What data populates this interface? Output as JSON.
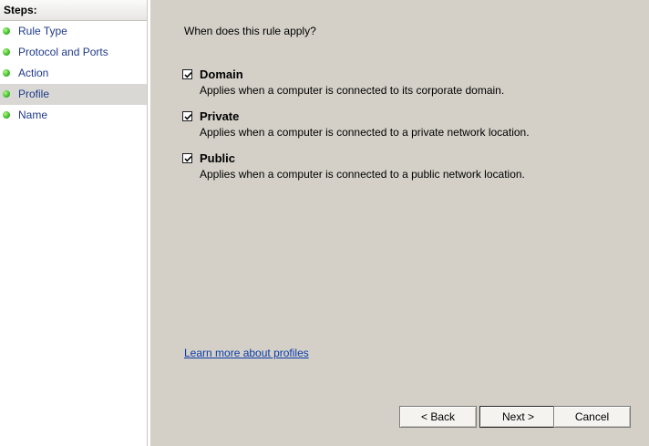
{
  "steps": {
    "header": "Steps:",
    "items": [
      {
        "label": "Rule Type"
      },
      {
        "label": "Protocol and Ports"
      },
      {
        "label": "Action"
      },
      {
        "label": "Profile"
      },
      {
        "label": "Name"
      }
    ]
  },
  "main": {
    "question": "When does this rule apply?",
    "profiles": [
      {
        "title": "Domain",
        "description": "Applies when a computer is connected to its corporate domain.",
        "checked": true
      },
      {
        "title": "Private",
        "description": "Applies when a computer is connected to a private network location.",
        "checked": true
      },
      {
        "title": "Public",
        "description": "Applies when a computer is connected to a public network location.",
        "checked": true
      }
    ],
    "learn_more": "Learn more about profiles"
  },
  "buttons": {
    "back": "< Back",
    "next": "Next >",
    "cancel": "Cancel"
  },
  "colors": {
    "step_text": "#1f3a8a",
    "link": "#0a3cab",
    "selected_step": "#d9d8d5",
    "dialog_bg": "#d4d0c8"
  }
}
